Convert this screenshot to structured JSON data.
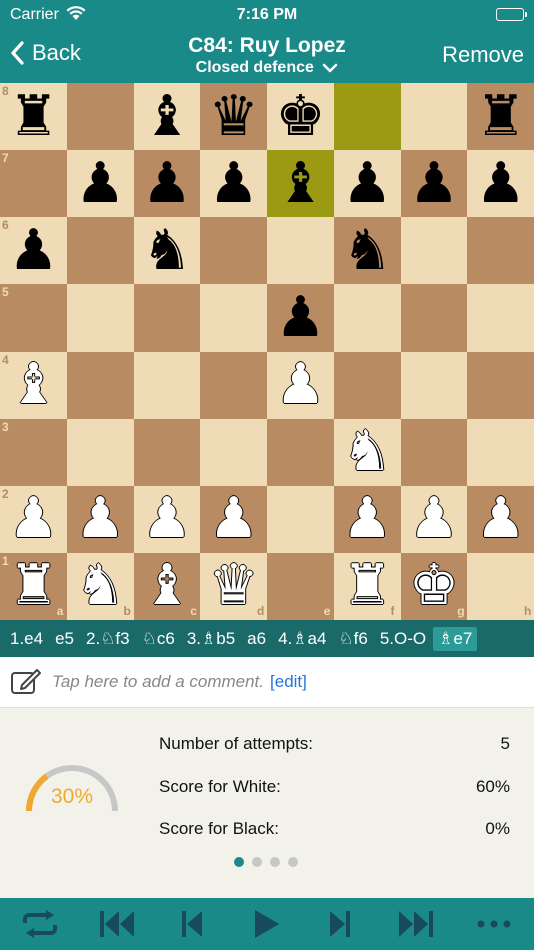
{
  "status": {
    "carrier": "Carrier",
    "time": "7:16 PM"
  },
  "nav": {
    "back_label": "Back",
    "title": "C84: Ruy Lopez",
    "subtitle": "Closed defence",
    "remove_label": "Remove"
  },
  "board": {
    "ranks": [
      "8",
      "7",
      "6",
      "5",
      "4",
      "3",
      "2",
      "1"
    ],
    "files": [
      "a",
      "b",
      "c",
      "d",
      "e",
      "f",
      "g",
      "h"
    ],
    "highlighted_squares": [
      "f8",
      "e7"
    ],
    "pieces": [
      {
        "sq": "a8",
        "color": "b",
        "type": "rook",
        "glyph": "♜"
      },
      {
        "sq": "c8",
        "color": "b",
        "type": "bishop",
        "glyph": "♝"
      },
      {
        "sq": "d8",
        "color": "b",
        "type": "queen",
        "glyph": "♛"
      },
      {
        "sq": "e8",
        "color": "b",
        "type": "king",
        "glyph": "♚"
      },
      {
        "sq": "h8",
        "color": "b",
        "type": "rook",
        "glyph": "♜"
      },
      {
        "sq": "b7",
        "color": "b",
        "type": "pawn",
        "glyph": "♟"
      },
      {
        "sq": "c7",
        "color": "b",
        "type": "pawn",
        "glyph": "♟"
      },
      {
        "sq": "d7",
        "color": "b",
        "type": "pawn",
        "glyph": "♟"
      },
      {
        "sq": "e7",
        "color": "b",
        "type": "bishop",
        "glyph": "♝"
      },
      {
        "sq": "f7",
        "color": "b",
        "type": "pawn",
        "glyph": "♟"
      },
      {
        "sq": "g7",
        "color": "b",
        "type": "pawn",
        "glyph": "♟"
      },
      {
        "sq": "h7",
        "color": "b",
        "type": "pawn",
        "glyph": "♟"
      },
      {
        "sq": "a6",
        "color": "b",
        "type": "pawn",
        "glyph": "♟"
      },
      {
        "sq": "c6",
        "color": "b",
        "type": "knight",
        "glyph": "♞"
      },
      {
        "sq": "f6",
        "color": "b",
        "type": "knight",
        "glyph": "♞"
      },
      {
        "sq": "e5",
        "color": "b",
        "type": "pawn",
        "glyph": "♟"
      },
      {
        "sq": "a4",
        "color": "w",
        "type": "bishop",
        "glyph": "♝"
      },
      {
        "sq": "e4",
        "color": "w",
        "type": "pawn",
        "glyph": "♟"
      },
      {
        "sq": "f3",
        "color": "w",
        "type": "knight",
        "glyph": "♞"
      },
      {
        "sq": "a2",
        "color": "w",
        "type": "pawn",
        "glyph": "♟"
      },
      {
        "sq": "b2",
        "color": "w",
        "type": "pawn",
        "glyph": "♟"
      },
      {
        "sq": "c2",
        "color": "w",
        "type": "pawn",
        "glyph": "♟"
      },
      {
        "sq": "d2",
        "color": "w",
        "type": "pawn",
        "glyph": "♟"
      },
      {
        "sq": "f2",
        "color": "w",
        "type": "pawn",
        "glyph": "♟"
      },
      {
        "sq": "g2",
        "color": "w",
        "type": "pawn",
        "glyph": "♟"
      },
      {
        "sq": "h2",
        "color": "w",
        "type": "pawn",
        "glyph": "♟"
      },
      {
        "sq": "a1",
        "color": "w",
        "type": "rook",
        "glyph": "♜"
      },
      {
        "sq": "b1",
        "color": "w",
        "type": "knight",
        "glyph": "♞"
      },
      {
        "sq": "c1",
        "color": "w",
        "type": "bishop",
        "glyph": "♝"
      },
      {
        "sq": "d1",
        "color": "w",
        "type": "queen",
        "glyph": "♛"
      },
      {
        "sq": "f1",
        "color": "w",
        "type": "rook",
        "glyph": "♜"
      },
      {
        "sq": "g1",
        "color": "w",
        "type": "king",
        "glyph": "♚"
      }
    ]
  },
  "moves": [
    "1.e4",
    "e5",
    "2.♘f3",
    "♘c6",
    "3.♗b5",
    "a6",
    "4.♗a4",
    "♘f6",
    "5.O-O",
    "♗e7"
  ],
  "current_move_index": 9,
  "comment": {
    "placeholder": "Tap here to add a comment.",
    "edit_label": "[edit]"
  },
  "stats": {
    "progress_label": "30%",
    "progress_value": 0.3,
    "rows": [
      {
        "label": "Number of attempts:",
        "value": "5"
      },
      {
        "label": "Score for White:",
        "value": "60%"
      },
      {
        "label": "Score for Black:",
        "value": "0%"
      }
    ],
    "pages": 4,
    "active_page": 0
  },
  "toolbar": {
    "buttons": [
      "flip-board-icon",
      "first-move-icon",
      "previous-move-icon",
      "play-icon",
      "next-move-icon",
      "last-move-icon",
      "more-icon"
    ]
  },
  "colors": {
    "teal": "#1a8a88",
    "light_square": "#efdbb5",
    "dark_square": "#b88b63",
    "highlight": "#9b9a12",
    "gauge_orange": "#f0a830"
  }
}
